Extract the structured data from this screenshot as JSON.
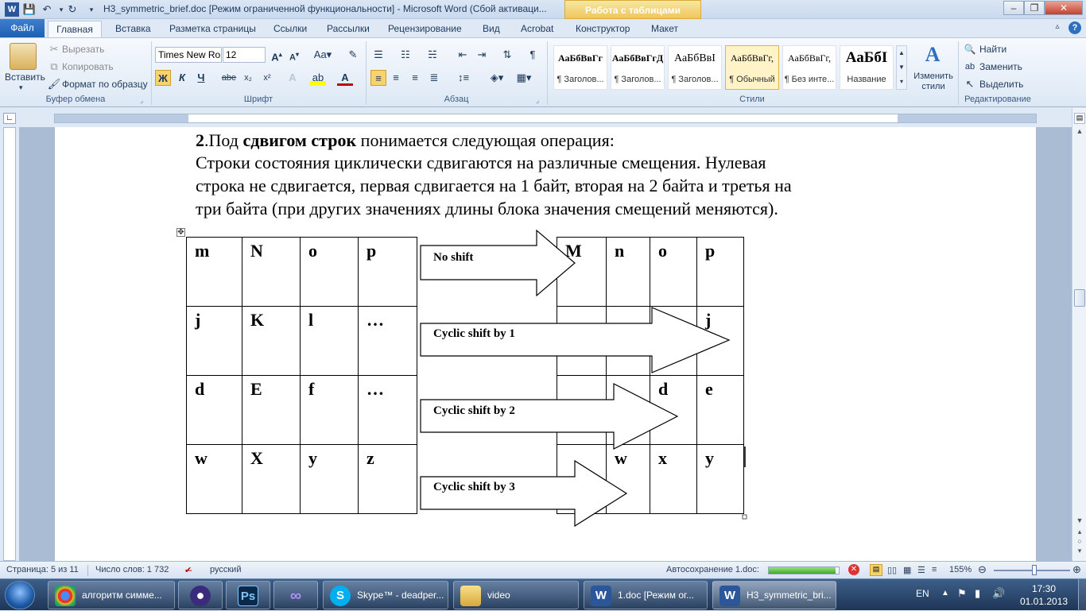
{
  "window": {
    "title": "H3_symmetric_brief.doc [Режим ограниченной функциональности]  -  Microsoft Word (Сбой активаци...",
    "context_tab": "Работа с таблицами",
    "minimize": "–",
    "maximize": "❐",
    "close": "✕"
  },
  "ribbon_tabs": [
    "Файл",
    "Главная",
    "Вставка",
    "Разметка страницы",
    "Ссылки",
    "Рассылки",
    "Рецензирование",
    "Вид",
    "Acrobat",
    "Конструктор",
    "Макет"
  ],
  "clipboard": {
    "paste": "Вставить",
    "cut": "Вырезать",
    "copy": "Копировать",
    "format_painter": "Формат по образцу",
    "label": "Буфер обмена"
  },
  "font": {
    "family": "Times New Ro",
    "size": "12",
    "bold": "Ж",
    "italic": "К",
    "underline": "Ч",
    "strike": "abe",
    "subscript": "x₂",
    "superscript": "x²",
    "label": "Шрифт"
  },
  "paragraph": {
    "label": "Абзац"
  },
  "styles": {
    "items": [
      {
        "preview": "АаБбВвГг",
        "name": "¶ Заголов..."
      },
      {
        "preview": "АаБбВвГгД",
        "name": "¶ Заголов..."
      },
      {
        "preview": "АаБбВвІ",
        "name": "¶ Заголов..."
      },
      {
        "preview": "АаБбВвГг,",
        "name": "¶ Обычный"
      },
      {
        "preview": "АаБбВвГг,",
        "name": "¶ Без инте..."
      },
      {
        "preview": "АаБбІ",
        "name": "Название"
      }
    ],
    "change": "Изменить стили",
    "label": "Стили"
  },
  "editing": {
    "find": "Найти",
    "replace": "Заменить",
    "select": "Выделить",
    "label": "Редактирование"
  },
  "document": {
    "line1_num": "2",
    "line1_a": ".Под ",
    "line1_bold": "сдвигом строк",
    "line1_b": " понимается следующая операция:",
    "para_line1": "Строки  состояния  циклически  сдвигаются  на  различные  смещения.  Нулевая",
    "para_line2": "строка не сдвигается, первая сдвигается на 1 байт,  вторая на 2 байта и третья на",
    "para_line3": "три байта (при других значениях длины блока значения смещений меняются).",
    "table": [
      [
        "m",
        "N",
        "o",
        "p",
        "",
        "M",
        "n",
        "o",
        "p"
      ],
      [
        "j",
        "K",
        "l",
        "…",
        "",
        "",
        "",
        "",
        "j"
      ],
      [
        "d",
        "E",
        "f",
        "…",
        "",
        "",
        "",
        "d",
        "e"
      ],
      [
        "w",
        "X",
        "y",
        "z",
        "",
        "",
        "w",
        "x",
        "y"
      ]
    ],
    "arrows": [
      "No shift",
      "Cyclic shift by 1",
      "Cyclic shift by 2",
      "Cyclic shift by 3"
    ]
  },
  "status": {
    "page": "Страница: 5 из 11",
    "words": "Число слов: 1 732",
    "language": "русский",
    "autosave": "Автосохранение 1.doc:",
    "zoom": "155%"
  },
  "taskbar": {
    "items": [
      {
        "label": "алгоритм симме..."
      },
      {
        "label": ""
      },
      {
        "label": ""
      },
      {
        "label": ""
      },
      {
        "label": "Skype™ - deadper..."
      },
      {
        "label": "video"
      },
      {
        "label": "1.doc [Режим ог..."
      },
      {
        "label": "H3_symmetric_bri..."
      }
    ],
    "lang": "EN",
    "time": "17:30",
    "date": "01.01.2013"
  }
}
